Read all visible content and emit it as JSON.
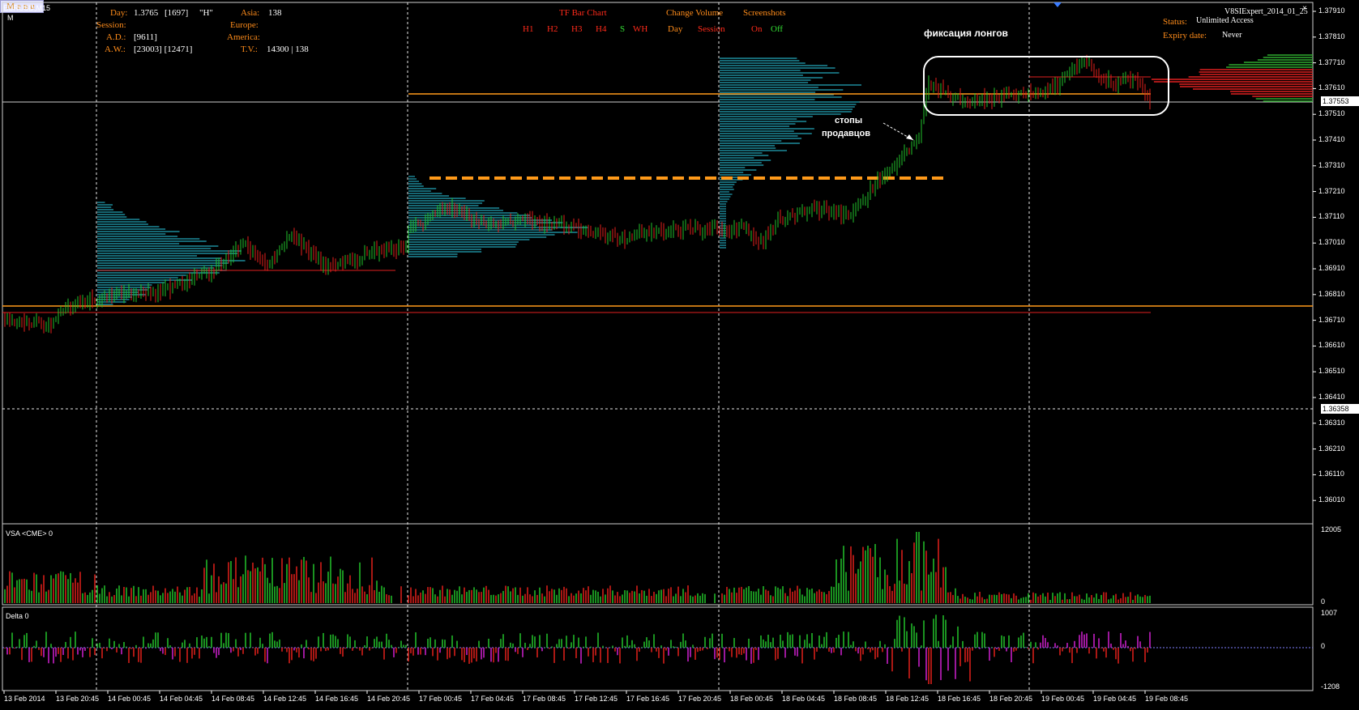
{
  "window": {
    "symbol_title": "EURUSD,M15",
    "mode_letter": "M"
  },
  "info_panel": {
    "day_label": "Day:",
    "day_value": "1.3765",
    "day_count": "[1697]",
    "day_flag": "\"H\"",
    "session_label": "Session:",
    "ad_label": "A.D.:",
    "ad_value": "[9611]",
    "aw_label": "A.W.:",
    "aw_value": "[23003] [12471]",
    "asia_label": "Asia:",
    "asia_value": "138",
    "europe_label": "Europe:",
    "america_label": "America:",
    "tv_label": "T.V.:",
    "tv_value": "14300 | 138"
  },
  "toolbar": {
    "tf_bar_chart": "TF Bar Chart",
    "tf_buttons": [
      "H1",
      "H2",
      "H3",
      "H4",
      "S",
      "WH"
    ],
    "change_volume": "Change Volume",
    "volume_buttons": [
      "Day",
      "Session"
    ],
    "screenshots": "Screenshots",
    "screenshot_on": "On",
    "screenshot_off": "Off"
  },
  "expert": {
    "name": "V8SIExpert_2014_01_25",
    "status_label": "Status:",
    "status_value": "Unlimited Access",
    "expiry_label": "Expiry date:",
    "expiry_value": "Never"
  },
  "annotations": {
    "long_fix": "фиксация лонгов",
    "seller_stops_1": "стопы",
    "seller_stops_2": "продавцов"
  },
  "menu_button": "Menu",
  "price_axis": {
    "ticks": [
      "1.37910",
      "1.37810",
      "1.37710",
      "1.37610",
      "1.37510",
      "1.37410",
      "1.37310",
      "1.37210",
      "1.37110",
      "1.37010",
      "1.36910",
      "1.36810",
      "1.36710",
      "1.36610",
      "1.36510",
      "1.36410",
      "1.36310",
      "1.36210",
      "1.36110",
      "1.36010"
    ],
    "current_price": "1.37553",
    "crosshair_price": "1.36358"
  },
  "vsa_panel": {
    "title": "VSA <CME> 0",
    "top_value": "12005",
    "bottom_value": "0"
  },
  "delta_panel": {
    "title": "Delta 0",
    "top_value": "1007",
    "zero_value": "0",
    "bottom_value": "-1208"
  },
  "time_axis": {
    "labels": [
      "13 Feb 2014",
      "13 Feb 20:45",
      "14 Feb 00:45",
      "14 Feb 04:45",
      "14 Feb 08:45",
      "14 Feb 12:45",
      "14 Feb 16:45",
      "14 Feb 20:45",
      "17 Feb 00:45",
      "17 Feb 04:45",
      "17 Feb 08:45",
      "17 Feb 12:45",
      "17 Feb 16:45",
      "17 Feb 20:45",
      "18 Feb 00:45",
      "18 Feb 04:45",
      "18 Feb 08:45",
      "18 Feb 12:45",
      "18 Feb 16:45",
      "18 Feb 20:45",
      "19 Feb 00:45",
      "19 Feb 04:45",
      "19 Feb 08:45"
    ]
  },
  "colors": {
    "background": "#000000",
    "bull_bar": "#22c22b",
    "bear_bar": "#e3201b",
    "profile": "#1d8a9a",
    "level_orange": "#ff9a1a",
    "level_red": "#e02020",
    "delta_purple": "#d020d0"
  }
}
